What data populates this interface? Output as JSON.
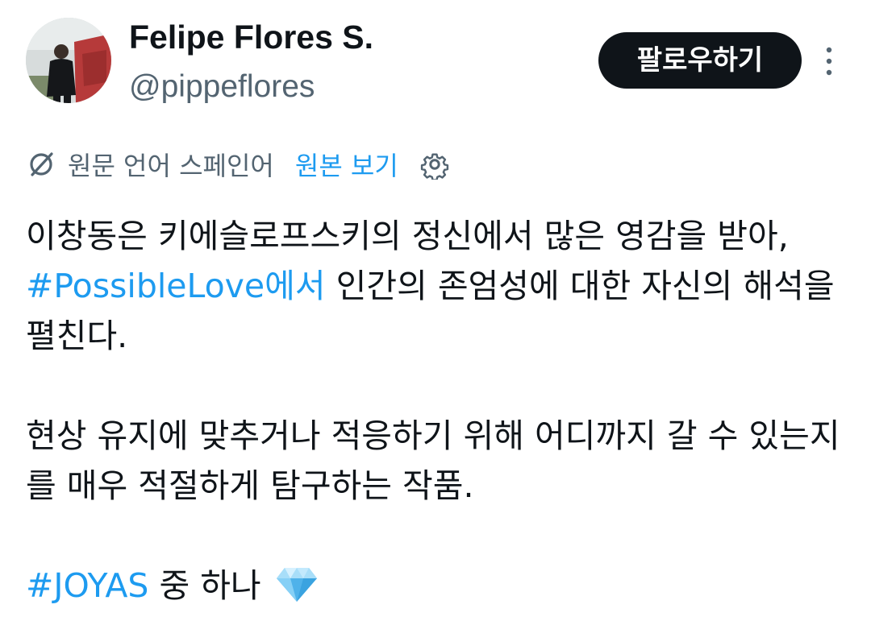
{
  "user": {
    "display_name": "Felipe Flores S.",
    "handle": "@pippeflores"
  },
  "actions": {
    "follow_label": "팔로우하기",
    "more_icon": "more-vertical-icon"
  },
  "translation": {
    "icon": "translate-icon",
    "source_label": "원문 언어 스페인어",
    "view_original_label": "원본 보기",
    "settings_icon": "gear-icon"
  },
  "tweet": {
    "p1_text_a": "이창동은 키에슬로프스키의 정신에서 많은 영감을 받아, ",
    "p1_hashtag": "#PossibleLove에서",
    "p1_text_b": " 인간의 존엄성에 대한 자신의 해석을 펼친다.",
    "p2_text": "현상 유지에 맞추거나 적응하기 위해 어디까지 갈 수 있는지를 매우 적절하게 탐구하는 작품.",
    "p3_hashtag": "#JOYAS",
    "p3_text": " 중 하나 ",
    "p3_emoji": "gem-icon"
  },
  "colors": {
    "link": "#1d9bf0",
    "muted": "#536471",
    "text": "#0f1419",
    "button_bg": "#0f1419"
  }
}
